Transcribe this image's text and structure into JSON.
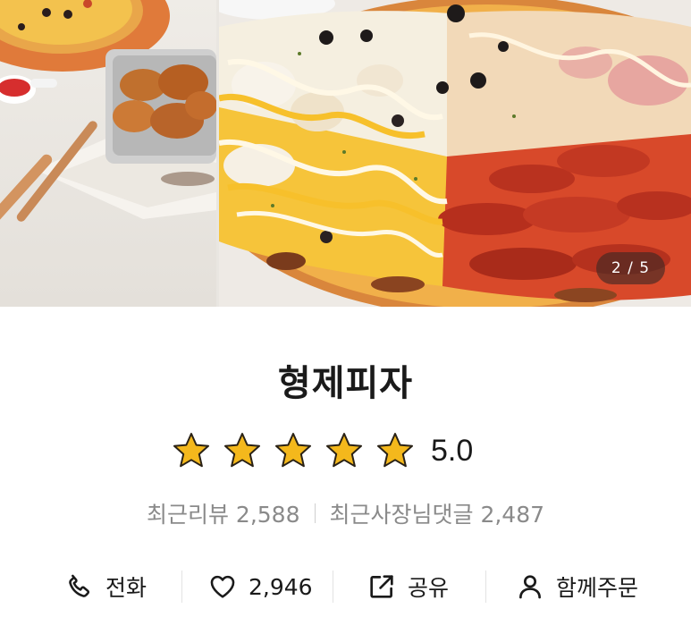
{
  "gallery": {
    "page_indicator": "2 / 5"
  },
  "store": {
    "name": "형제피자",
    "rating": "5.0",
    "star_count": 5,
    "star_color": "#f4b81c"
  },
  "reviews": {
    "recent_reviews": "최근리뷰 2,588",
    "owner_replies": "최근사장님댓글 2,487"
  },
  "actions": {
    "call_label": "전화",
    "like_count": "2,946",
    "share_label": "공유",
    "group_order_label": "함께주문"
  }
}
